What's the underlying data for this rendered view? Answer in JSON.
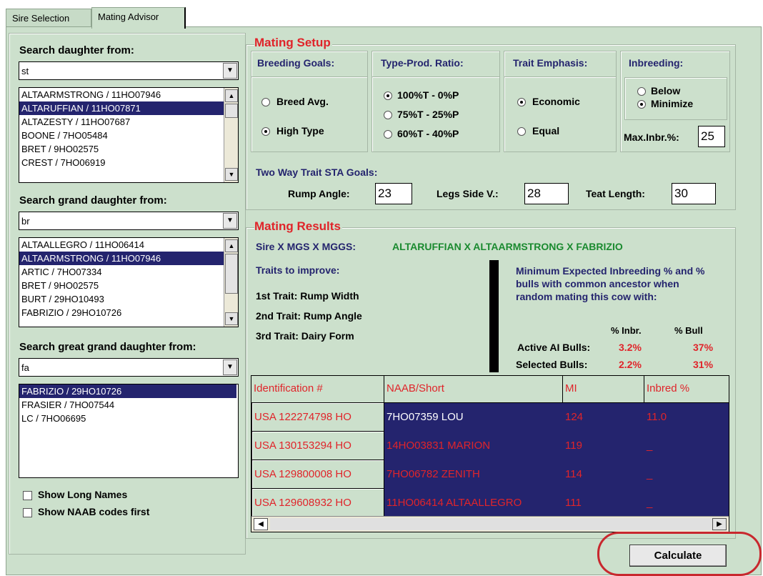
{
  "tabs": [
    "Sire Selection",
    "Mating Advisor"
  ],
  "left": {
    "daughter": {
      "label": "Search daughter from:",
      "query": "st",
      "items": [
        "ALTAARMSTRONG / 11HO07946",
        "ALTARUFFIAN / 11HO07871",
        "ALTAZESTY / 11HO07687",
        "BOONE / 7HO05484",
        "BRET / 9HO02575",
        "CREST / 7HO06919"
      ],
      "selected_index": 1
    },
    "grand_daughter": {
      "label": "Search grand daughter from:",
      "query": "br",
      "items": [
        "ALTAALLEGRO / 11HO06414",
        "ALTAARMSTRONG / 11HO07946",
        "ARTIC / 7HO07334",
        "BRET / 9HO02575",
        "BURT / 29HO10493",
        "FABRIZIO / 29HO10726"
      ],
      "selected_index": 1
    },
    "great_grand_daughter": {
      "label": "Search great grand daughter from:",
      "query": "fa",
      "items": [
        "FABRIZIO / 29HO10726",
        "FRASIER / 7HO07544",
        "LC / 7HO06695"
      ],
      "selected_index": 0
    },
    "show_long_names": "Show Long Names",
    "show_naab_first": "Show NAAB codes first"
  },
  "setup": {
    "title": "Mating Setup",
    "breeding_goals": {
      "label": "Breeding Goals:",
      "options": [
        "Breed Avg.",
        "High Type"
      ],
      "selected": 1
    },
    "type_prod": {
      "label": "Type-Prod. Ratio:",
      "options": [
        "100%T - 0%P",
        "75%T - 25%P",
        "60%T - 40%P"
      ],
      "selected": 0
    },
    "trait_emphasis": {
      "label": "Trait Emphasis:",
      "options": [
        "Economic",
        "Equal"
      ],
      "selected": 0
    },
    "inbreeding": {
      "label": "Inbreeding:",
      "options": [
        "Below",
        "Minimize"
      ],
      "selected": 1,
      "max_label": "Max.Inbr.%:",
      "max_value": "25"
    },
    "sta_goals": {
      "label": "Two Way Trait STA Goals:",
      "rump_angle_label": "Rump Angle:",
      "rump_angle": "23",
      "legs_label": "Legs Side V.:",
      "legs": "28",
      "teat_label": "Teat Length:",
      "teat": "30"
    }
  },
  "results": {
    "title": "Mating Results",
    "sire_label": "Sire X MGS X MGGS:",
    "sire_value": "ALTARUFFIAN X ALTAARMSTRONG X FABRIZIO",
    "traits_label": "Traits to improve:",
    "trait1": "1st Trait: Rump Width",
    "trait2": "2nd Trait: Rump Angle",
    "trait3": "3rd Trait: Dairy Form",
    "inbr_text": "Minimum Expected Inbreeding % and % bulls with common ancestor when random mating this cow with:",
    "col_inbr": "% Inbr.",
    "col_bull": "% Bull",
    "active_label": "Active AI Bulls:",
    "active_inbr": "3.2%",
    "active_bull": "37%",
    "selected_label": "Selected Bulls:",
    "selected_inbr": "2.2%",
    "selected_bull": "31%",
    "grid_headers": [
      "Identification #",
      "NAAB/Short",
      "MI",
      "Inbred %"
    ],
    "grid_rows": [
      [
        "USA 122274798 HO",
        "7HO07359   LOU",
        "124",
        "11.0"
      ],
      [
        "USA 130153294 HO",
        "14HO03831   MARION",
        "119",
        "_"
      ],
      [
        "USA 129800008 HO",
        "7HO06782   ZENITH",
        "114",
        "_"
      ],
      [
        "USA 129608932 HO",
        "11HO06414   ALTAALLEGRO",
        "111",
        "_"
      ]
    ]
  },
  "calculate_label": "Calculate"
}
